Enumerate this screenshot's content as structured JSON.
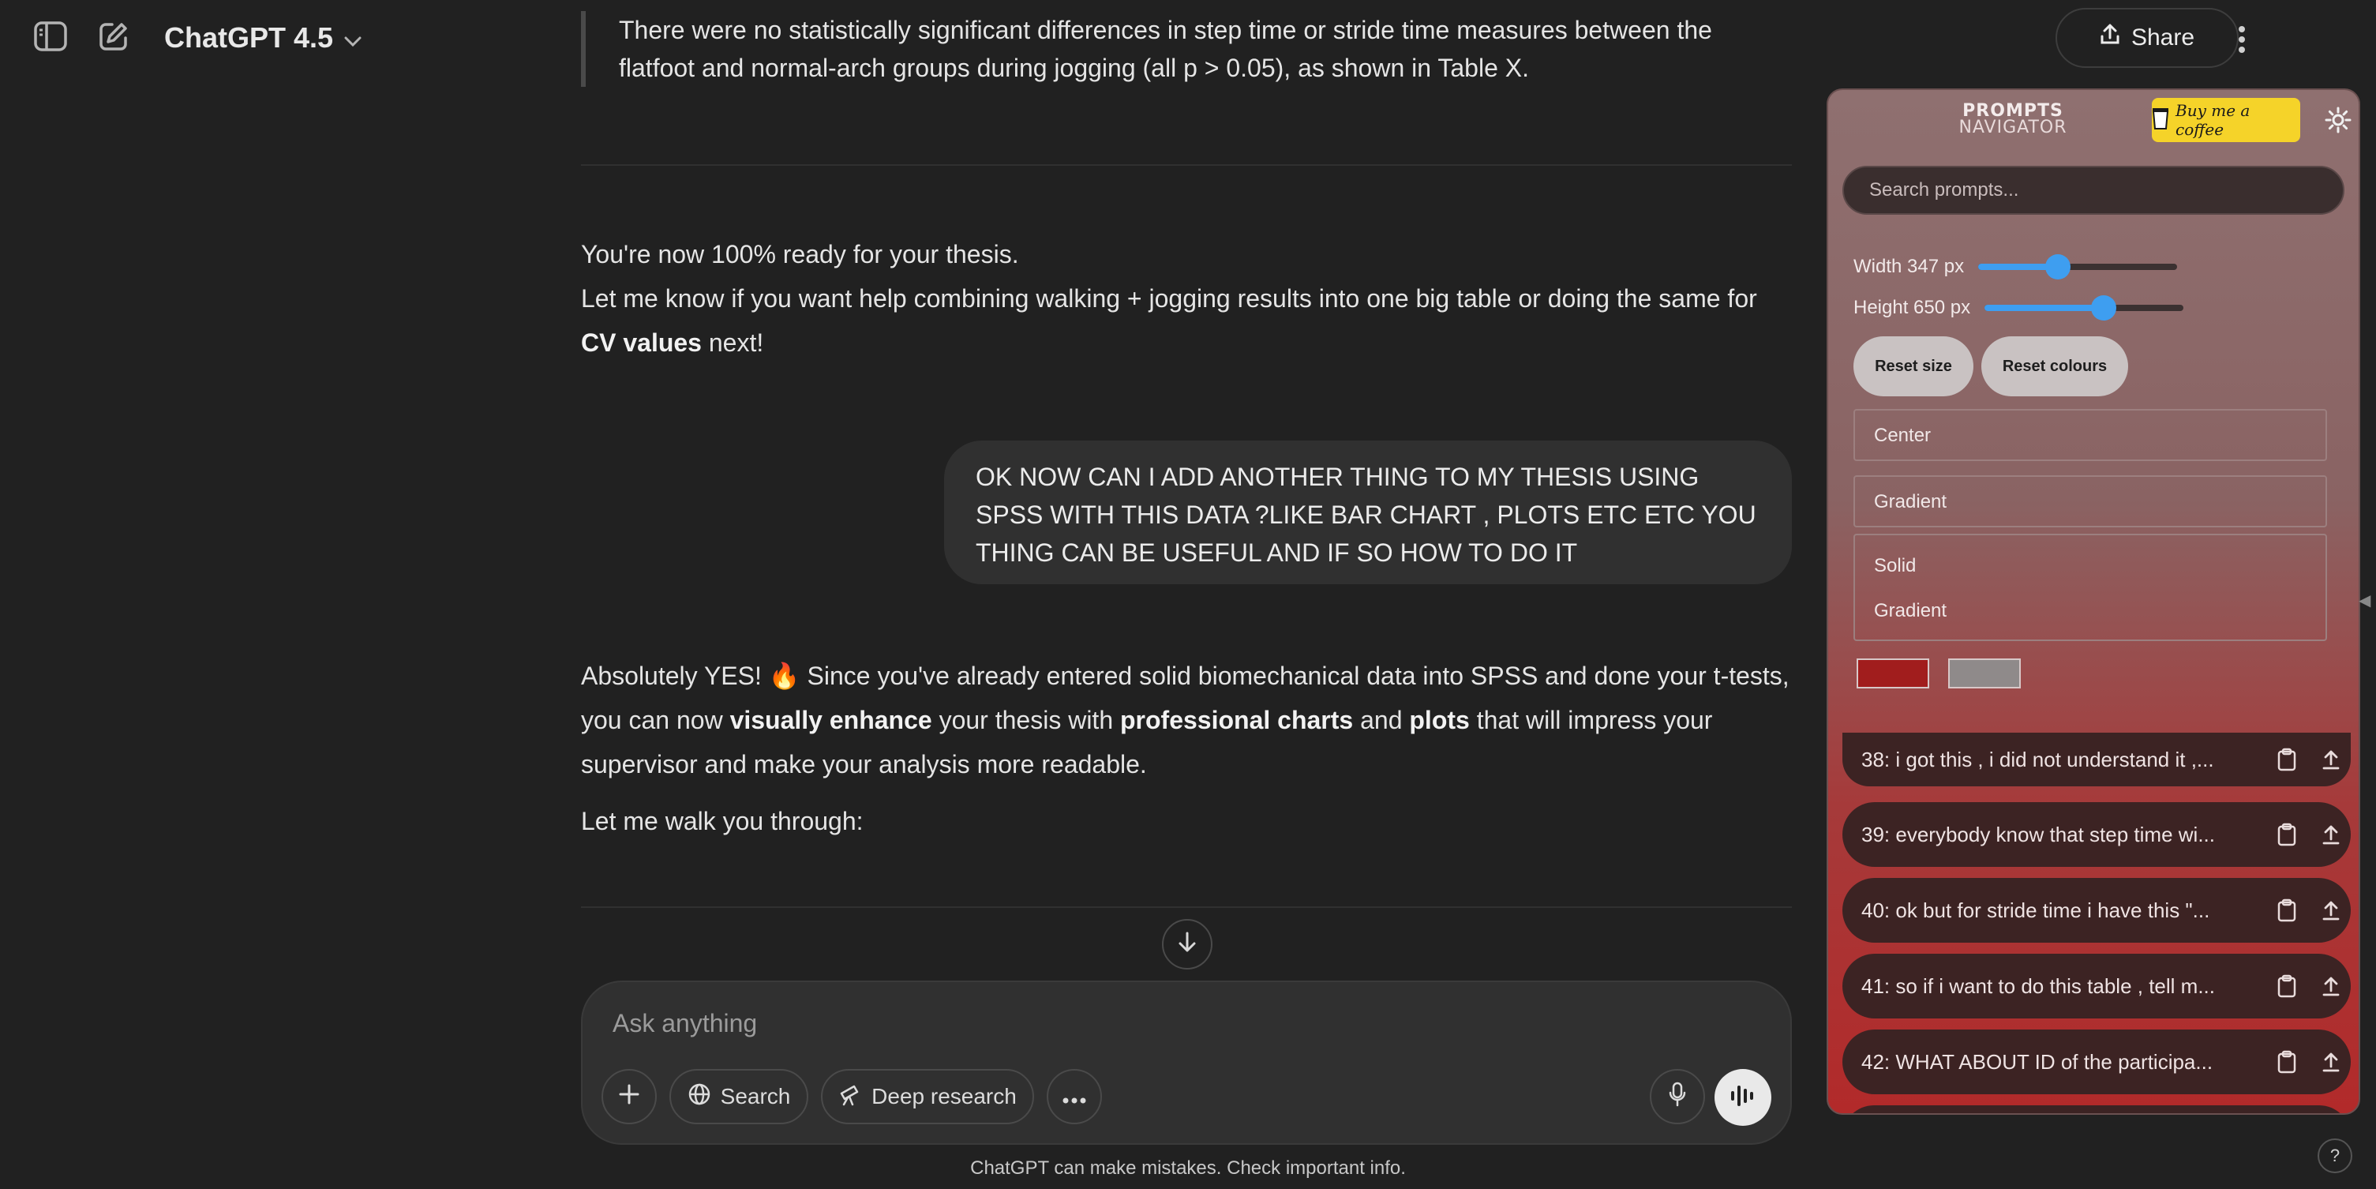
{
  "header": {
    "model_name": "ChatGPT 4.5",
    "share_label": "Share",
    "icons": {
      "sidebar": "sidebar-toggle-icon",
      "new_chat": "edit-icon",
      "chevron": "chevron-down-icon",
      "share": "upload-icon",
      "more": "more-vertical-icon"
    }
  },
  "conversation": {
    "quote_text": "There were no statistically significant differences in step time or stride time measures between the flatfoot and normal-arch groups during jogging (all p > 0.05), as shown in Table X.",
    "ready_line": "You're now 100% ready for your thesis.",
    "help_line_start": "Let me know if you want help combining walking + jogging results into one big table or doing the same for",
    "help_line_bold": "CV values",
    "help_line_end": " next!",
    "user_message": "OK NOW CAN I ADD ANOTHER THING TO MY THESIS USING SPSS WITH THIS DATA ?LIKE BAR CHART , PLOTS ETC ETC YOU THING CAN BE USEFUL AND IF SO HOW TO DO IT",
    "answer_p1": "Absolutely YES! 🔥 Since you've already entered solid biomechanical data into SPSS and done your t-tests, you can now",
    "answer_b1": "visually enhance",
    "answer_p2": " your thesis with ",
    "answer_b2": "professional charts",
    "answer_p3": " and ",
    "answer_b3": "plots",
    "answer_p4": " that will impress your supervisor and make your analysis more readable.",
    "walk_line": "Let me walk you through:"
  },
  "composer": {
    "placeholder": "Ask anything",
    "search_label": "Search",
    "deep_research_label": "Deep research",
    "footnote": "ChatGPT can make mistakes. Check important info."
  },
  "prompts_navigator": {
    "logo_line1": "PROMPTS",
    "logo_line2": "NAVIGATOR",
    "coffee_label": "Buy me a coffee",
    "search_placeholder": "Search prompts...",
    "width_label": "Width 347 px",
    "height_label": "Height 650 px",
    "width_value": 347,
    "height_value": 650,
    "width_fraction": 0.4,
    "height_fraction": 0.6,
    "reset_size_label": "Reset size",
    "reset_colours_label": "Reset colours",
    "position_option": "Center",
    "style_option": "Gradient",
    "background_options": [
      "Solid",
      "Gradient"
    ],
    "colors": {
      "primary": "#a11d1d",
      "secondary": "#8f8a8a"
    },
    "items": [
      {
        "label": "38: i got this , i did not understand it ,..."
      },
      {
        "label": "39: everybody know that step time wi..."
      },
      {
        "label": "40: ok but for stride time i have this \"..."
      },
      {
        "label": "41: so if i want to do this table , tell m..."
      },
      {
        "label": "42: WHAT ABOUT ID of the participa..."
      }
    ]
  },
  "help_label": "?"
}
